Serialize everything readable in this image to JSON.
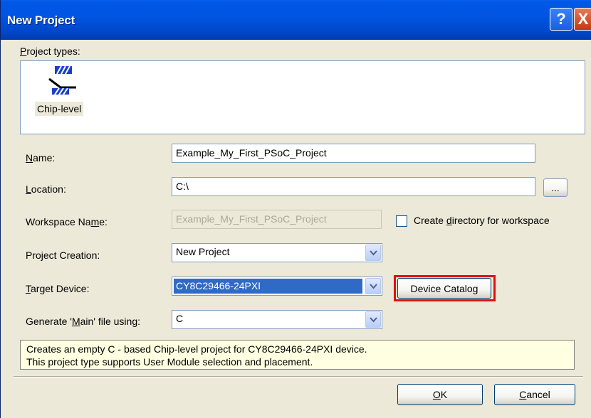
{
  "window": {
    "title": "New Project",
    "help_glyph": "?",
    "close_glyph": "X"
  },
  "project_types": {
    "label_prefix": "",
    "label_u": "P",
    "label_rest": "roject types:",
    "items": [
      {
        "label": "Chip-level",
        "icon": "chip-level-icon"
      }
    ]
  },
  "form": {
    "name": {
      "label_u": "N",
      "label_rest": "ame:",
      "value": "Example_My_First_PSoC_Project"
    },
    "location": {
      "label_u": "L",
      "label_rest": "ocation:",
      "value": "C:\\",
      "browse_label": "..."
    },
    "workspace": {
      "label_pre": "Workspace Na",
      "label_u": "m",
      "label_rest": "e:",
      "value": "Example_My_First_PSoC_Project",
      "checkbox_pre": "Create ",
      "checkbox_u": "d",
      "checkbox_rest": "irectory for workspace",
      "checked": false
    },
    "project_creation": {
      "label": "Project Creation:",
      "value": "New Project"
    },
    "target_device": {
      "label_u": "T",
      "label_rest": "arget Device:",
      "value": "CY8C29466-24PXI",
      "catalog_label": "Device Catalog"
    },
    "main_file": {
      "label_pre": "Generate '",
      "label_u": "M",
      "label_rest": "ain' file using:",
      "value": "C"
    }
  },
  "info": {
    "line1": "Creates an empty C - based Chip-level project for CY8C29466-24PXI device.",
    "line2": "This project type supports User Module selection and placement."
  },
  "buttons": {
    "ok_u": "O",
    "ok_rest": "K",
    "cancel_u": "C",
    "cancel_rest": "ancel"
  },
  "colors": {
    "titlebar": "#0055e2",
    "dialog_bg": "#ece9d8",
    "selection": "#316ac5",
    "highlight_border": "#e30e0e",
    "info_bg": "#ffffe1"
  }
}
